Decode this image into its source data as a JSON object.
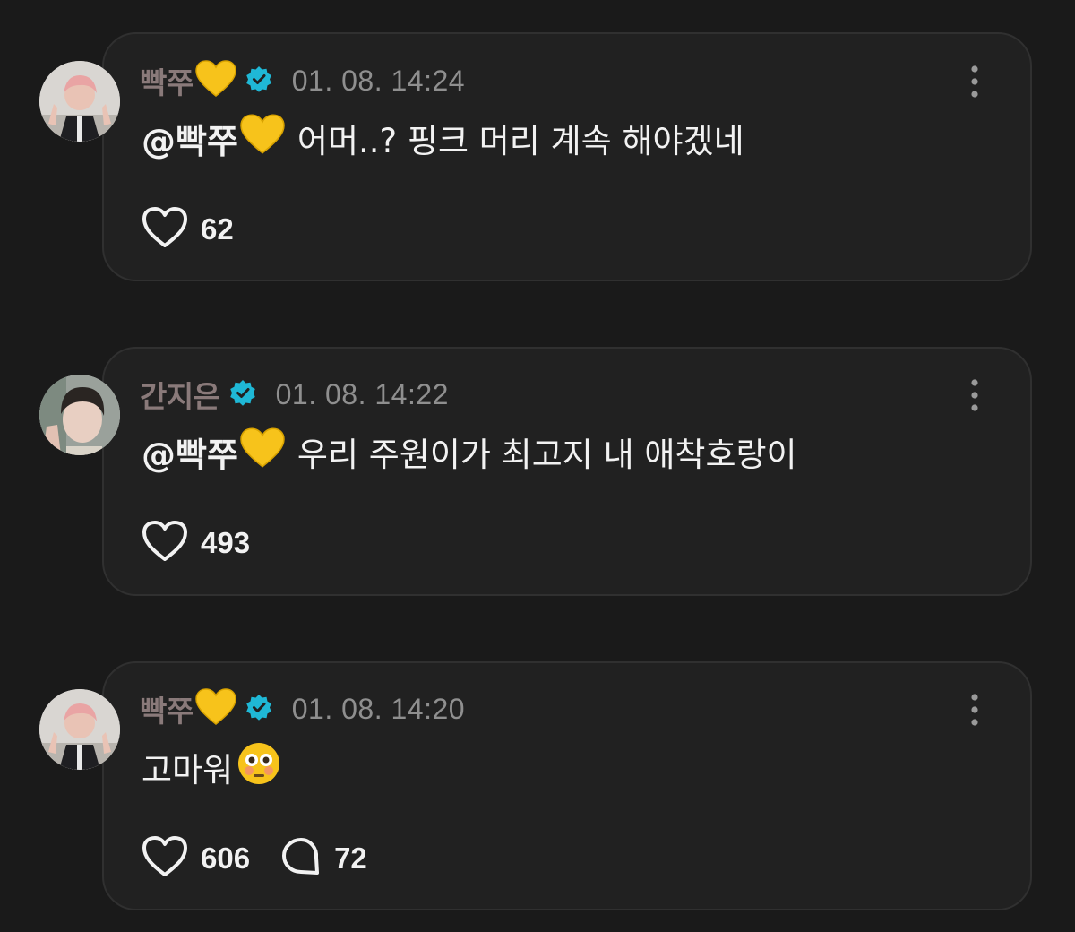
{
  "comments": [
    {
      "username": "빡쭈",
      "has_heart_emoji": true,
      "verified": true,
      "timestamp": "01. 08. 14:24",
      "mention": "@빡쭈",
      "mention_heart_emoji": true,
      "text": "어머..? 핑크 머리 계속 해야겠네",
      "likes": "62",
      "replies": null
    },
    {
      "username": "간지은",
      "has_heart_emoji": false,
      "verified": true,
      "timestamp": "01. 08. 14:22",
      "mention": "@빡쭈",
      "mention_heart_emoji": true,
      "text": "우리 주원이가 최고지 내 애착호랑이",
      "likes": "493",
      "replies": null
    },
    {
      "username": "빡쭈",
      "has_heart_emoji": true,
      "verified": true,
      "timestamp": "01. 08. 14:20",
      "mention": "",
      "mention_heart_emoji": false,
      "text": "고마워",
      "text_emoji": "flushed-face",
      "likes": "606",
      "replies": "72"
    }
  ],
  "icons": {
    "heart": "heart-outline-icon",
    "reply": "speech-bubble-icon",
    "more": "more-vertical-icon",
    "verified": "verified-badge-icon",
    "yellow_heart": "yellow-heart-emoji"
  },
  "colors": {
    "background": "#1a1a1a",
    "card": "#212121",
    "username": "#8a7a7a",
    "verified": "#1fb8d6",
    "yellow_heart": "#f7c31b"
  }
}
